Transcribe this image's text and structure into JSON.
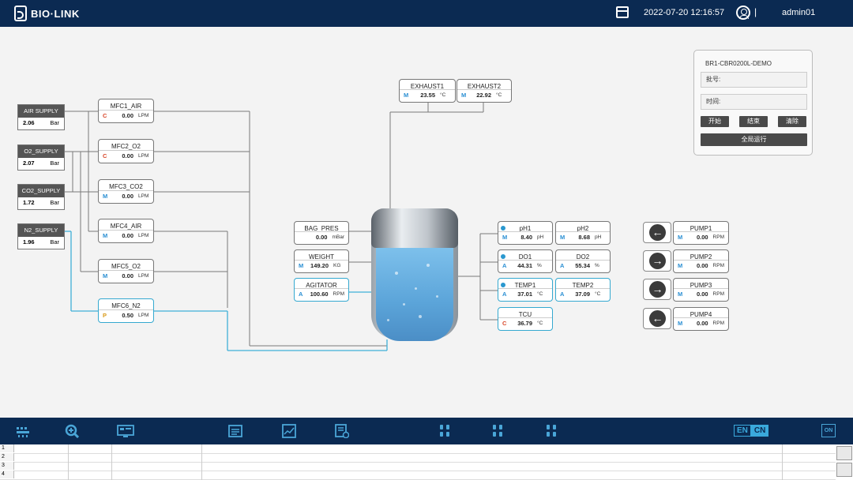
{
  "header": {
    "brand": "BIO·LINK",
    "datetime": "2022-07-20 12:16:57",
    "separator": "|",
    "user": "admin01"
  },
  "supplies": [
    {
      "name": "AIR SUPPLY",
      "value": "2.06",
      "unit": "Bar"
    },
    {
      "name": "O2_SUPPLY",
      "value": "2.07",
      "unit": "Bar"
    },
    {
      "name": "CO2_SUPPLY",
      "value": "1.72",
      "unit": "Bar"
    },
    {
      "name": "N2_SUPPLY",
      "value": "1.96",
      "unit": "Bar"
    }
  ],
  "mfcs": [
    {
      "name": "MFC1_AIR",
      "mode": "C",
      "value": "0.00",
      "unit": "LPM"
    },
    {
      "name": "MFC2_O2",
      "mode": "C",
      "value": "0.00",
      "unit": "LPM"
    },
    {
      "name": "MFC3_CO2",
      "mode": "M",
      "value": "0.00",
      "unit": "LPM"
    },
    {
      "name": "MFC4_AIR",
      "mode": "M",
      "value": "0.00",
      "unit": "LPM"
    },
    {
      "name": "MFC5_O2",
      "mode": "M",
      "value": "0.00",
      "unit": "LPM"
    },
    {
      "name": "MFC6_N2",
      "mode": "P",
      "value": "0.50",
      "unit": "LPM"
    }
  ],
  "exhausts": [
    {
      "name": "EXHAUST1",
      "mode": "M",
      "value": "23.55",
      "unit": "°C"
    },
    {
      "name": "EXHAUST2",
      "mode": "M",
      "value": "22.92",
      "unit": "°C"
    }
  ],
  "left_sensors": [
    {
      "name": "BAG_PRES",
      "mode": "",
      "value": "0.00",
      "unit": "mBar"
    },
    {
      "name": "WEIGHT",
      "mode": "M",
      "value": "149.20",
      "unit": "KG"
    },
    {
      "name": "AGITATOR",
      "mode": "A",
      "value": "100.60",
      "unit": "RPM"
    }
  ],
  "right_sensors": [
    {
      "name": "pH1",
      "mode": "M",
      "value": "8.40",
      "unit": "pH"
    },
    {
      "name": "pH2",
      "mode": "M",
      "value": "8.68",
      "unit": "pH"
    },
    {
      "name": "DO1",
      "mode": "A",
      "value": "44.31",
      "unit": "%"
    },
    {
      "name": "DO2",
      "mode": "A",
      "value": "55.34",
      "unit": "%"
    },
    {
      "name": "TEMP1",
      "mode": "A",
      "value": "37.01",
      "unit": "°C"
    },
    {
      "name": "TEMP2",
      "mode": "A",
      "value": "37.09",
      "unit": "°C"
    },
    {
      "name": "TCU",
      "mode": "C",
      "value": "36.79",
      "unit": "°C"
    }
  ],
  "pumps": [
    {
      "name": "PUMP1",
      "mode": "M",
      "value": "0.00",
      "unit": "RPM",
      "arrow": "←"
    },
    {
      "name": "PUMP2",
      "mode": "M",
      "value": "0.00",
      "unit": "RPM",
      "arrow": "→"
    },
    {
      "name": "PUMP3",
      "mode": "M",
      "value": "0.00",
      "unit": "RPM",
      "arrow": "→"
    },
    {
      "name": "PUMP4",
      "mode": "M",
      "value": "0.00",
      "unit": "RPM",
      "arrow": "←"
    }
  ],
  "batch_panel": {
    "title": "BR1-CBR0200L-DEMO",
    "batch_label": "批号:",
    "time_label": "时间:",
    "start_label": "开始",
    "end_label": "结束",
    "clear_label": "清除",
    "global_run_label": "全局运行"
  },
  "footer": {
    "lang_en": "EN",
    "lang_cn": "CN",
    "on_label": "ON"
  },
  "grid_rows": [
    "1",
    "2",
    "3",
    "4"
  ],
  "colors": {
    "navbar": "#0b2a52",
    "accent": "#35a9d0"
  }
}
